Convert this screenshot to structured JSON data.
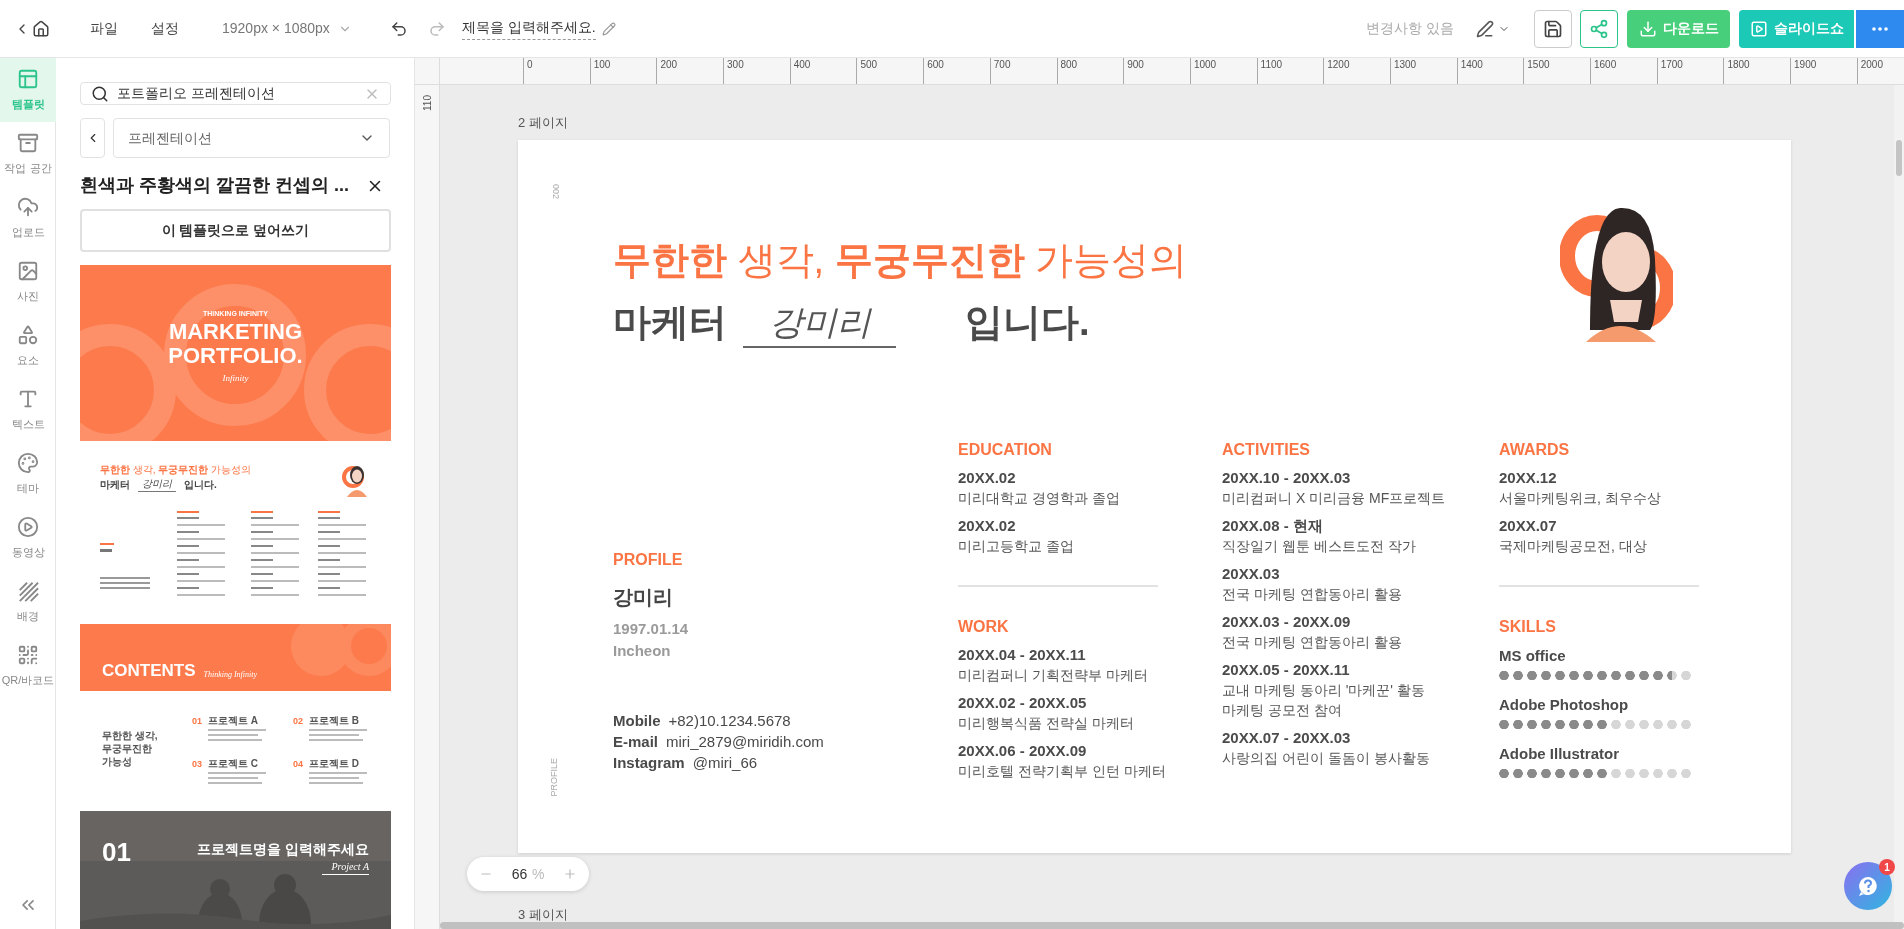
{
  "topbar": {
    "menus": [
      {
        "label": "파일"
      },
      {
        "label": "설정"
      }
    ],
    "size": "1920px × 1080px",
    "title": "제목을 입력해주세요.",
    "status": "변경사항 있음",
    "download": "다운로드",
    "slideshow": "슬라이드쇼"
  },
  "rail": [
    {
      "label": "템플릿",
      "kind": "template",
      "selected": true
    },
    {
      "label": "작업 공간",
      "kind": "workspace",
      "selected": false
    },
    {
      "label": "업로드",
      "kind": "upload",
      "selected": false
    },
    {
      "label": "사진",
      "selected": false
    },
    {
      "label": "요소",
      "kind": "elements",
      "selected": false
    },
    {
      "label": "텍스트",
      "kind": "text",
      "selected": false
    },
    {
      "label": "테마",
      "kind": "theme",
      "selected": false
    },
    {
      "label": "동영상",
      "kind": "video",
      "selected": false
    },
    {
      "label": "배경",
      "kind": "background",
      "selected": false
    },
    {
      "label": "QR/바코드",
      "kind": "qr",
      "selected": false
    }
  ],
  "panel": {
    "search": {
      "value": "포트폴리오 프레젠테이션"
    },
    "category": "프레젠테이션",
    "template_title": "흰색과 주황색의 깔끔한 컨셉의 ...",
    "apply_button": "이 템플릿으로 덮어쓰기",
    "thumbnails": [
      {
        "kind": "cover",
        "tagline": "THINKING INFINITY",
        "title_lines": [
          "MARKETING",
          "PORTFOLIO."
        ],
        "script": "Infinity"
      },
      {
        "kind": "profile",
        "headline": "**무한한** 생각, **무궁무진한** 가능성의",
        "before": "마케터",
        "signature": "강미리",
        "after": "입니다."
      },
      {
        "kind": "banner",
        "title": "CONTENTS",
        "script": "Thinking Infinity"
      },
      {
        "kind": "contents",
        "headline_lines": [
          "무한한 생각,",
          "무궁무진한",
          "가능성"
        ],
        "items": [
          {
            "number": "01",
            "title": "프로젝트 A"
          },
          {
            "number": "02",
            "title": "프로젝트 B"
          },
          {
            "number": "03",
            "title": "프로젝트 C"
          },
          {
            "number": "04",
            "title": "프로젝트 D"
          }
        ]
      },
      {
        "kind": "section",
        "number": "01",
        "title": "프로젝트명을 입력해주세요",
        "script": "Project A"
      }
    ]
  },
  "ruler": {
    "x_labels": [
      "0",
      "100",
      "200",
      "300",
      "400",
      "500",
      "600",
      "700",
      "800",
      "900",
      "1000",
      "1100",
      "1200",
      "1300",
      "1400",
      "1500",
      "1600",
      "1700",
      "1800",
      "1900",
      "2000"
    ],
    "y_label": "110"
  },
  "pages": [
    {
      "label": "2 페이지"
    },
    {
      "label": "3 페이지"
    }
  ],
  "slide": {
    "page_mark": "002",
    "side_mark": "PROFILE",
    "headline": "**무한한** 생각, **무궁무진한** 가능성의",
    "before": "마케터",
    "signature": "강미리",
    "after": "입니다.",
    "profile": {
      "heading": "PROFILE",
      "name": "강미리",
      "birth": "1997.01.14",
      "city": "Incheon",
      "contacts": [
        {
          "label": "Mobile",
          "value": "+82)10.1234.5678"
        },
        {
          "label": "E-mail",
          "value": "miri_2879@miridih.com"
        },
        {
          "label": "Instagram",
          "value": "@miri_66"
        }
      ]
    },
    "columns": [
      {
        "sections": [
          {
            "heading": "EDUCATION",
            "kind": "entries",
            "entries": [
              {
                "date": "20XX.02",
                "text": "미리대학교 경영학과 졸업"
              },
              {
                "date": "20XX.02",
                "text": "미리고등학교 졸업"
              }
            ]
          },
          {
            "heading": "WORK",
            "kind": "entries",
            "entries": [
              {
                "date": "20XX.04 - 20XX.11",
                "text": "미리컴퍼니 기획전략부 마케터"
              },
              {
                "date": "20XX.02 - 20XX.05",
                "text": "미리행복식품 전략실 마케터"
              },
              {
                "date": "20XX.06 - 20XX.09",
                "text": "미리호텔 전략기획부 인턴 마케터"
              }
            ]
          }
        ]
      },
      {
        "sections": [
          {
            "heading": "ACTIVITIES",
            "kind": "entries",
            "entries": [
              {
                "date": "20XX.10 - 20XX.03",
                "text": "미리컴퍼니 X 미리금융 MF프로젝트"
              },
              {
                "date": "20XX.08 - 현재",
                "text": "직장일기 웹툰 베스트도전 작가"
              },
              {
                "date": "20XX.03",
                "text": "전국 마케팅 연합동아리 활용"
              },
              {
                "date": "20XX.03 - 20XX.09",
                "text": "전국 마케팅 연합동아리 활용"
              },
              {
                "date": "20XX.05 - 20XX.11",
                "text": "교내 마케팅 동아리 '마케꾼' 활동\n마케팅 공모전 참여"
              },
              {
                "date": "20XX.07 - 20XX.03",
                "text": "사랑의집 어린이 돌돔이 봉사활동"
              }
            ]
          }
        ]
      },
      {
        "sections": [
          {
            "heading": "AWARDS",
            "kind": "entries",
            "entries": [
              {
                "date": "20XX.12",
                "text": "서울마케팅위크, 최우수상"
              },
              {
                "date": "20XX.07",
                "text": "국제마케팅공모전, 대상"
              }
            ]
          },
          {
            "heading": "SKILLS",
            "kind": "skills",
            "skills": [
              {
                "name": "MS office",
                "level": 0.893
              },
              {
                "name": "Adobe Photoshop",
                "level": 0.571
              },
              {
                "name": "Adobe Illustrator",
                "level": 0.571
              }
            ]
          }
        ]
      }
    ]
  },
  "zoom": {
    "value": "66",
    "unit": "%"
  },
  "help": {
    "badge": "1"
  }
}
